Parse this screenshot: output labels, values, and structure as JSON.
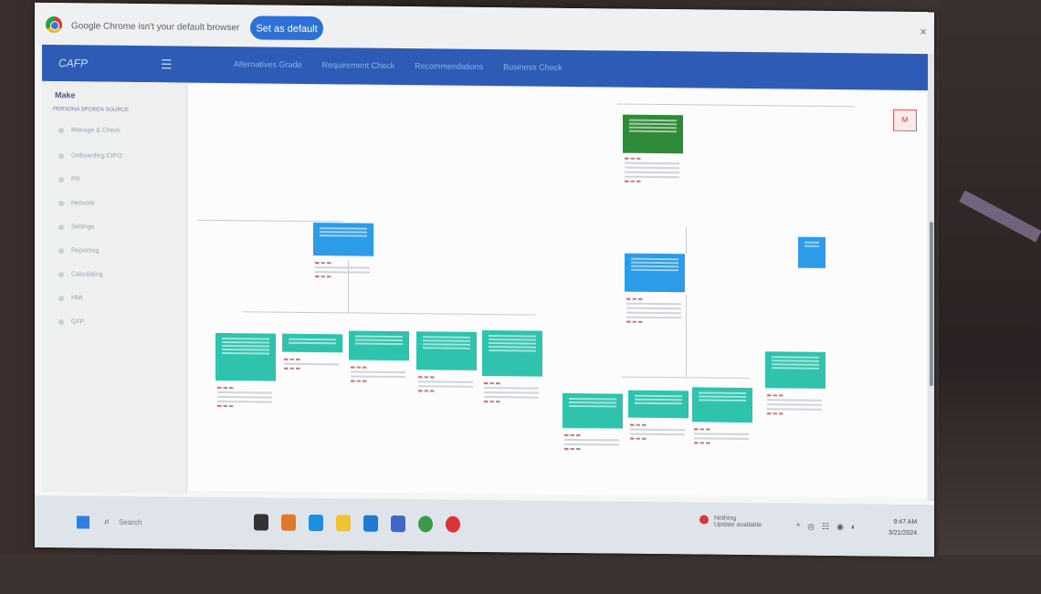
{
  "browser": {
    "infobar_text": "Google Chrome isn't your default browser",
    "set_default_label": "Set as default",
    "close_label": "×"
  },
  "app": {
    "logo": "CAFP",
    "nav": [
      "Alternatives Grade",
      "Requirement Check",
      "Recommendations",
      "Business Check"
    ]
  },
  "sidebar": {
    "header": "Make",
    "subtitle": "PERSONA SPOKEN SOURCE",
    "items": [
      "Manage & Check",
      "Onboarding CIPO",
      "PR",
      "Network",
      "Settings",
      "Reporting",
      "Calculating",
      "HMI",
      "QFP"
    ]
  },
  "alert_badge": "M",
  "taskbar": {
    "search_placeholder": "Search",
    "tray_text": "Nothing",
    "tray_sub": "Update available",
    "time": "9:47 AM",
    "date": "3/21/2024"
  },
  "colors": {
    "appbar": "#2d5bb6",
    "node_teal": "#2fc3ad",
    "node_blue": "#2c9be8",
    "node_green": "#2f8a39"
  }
}
